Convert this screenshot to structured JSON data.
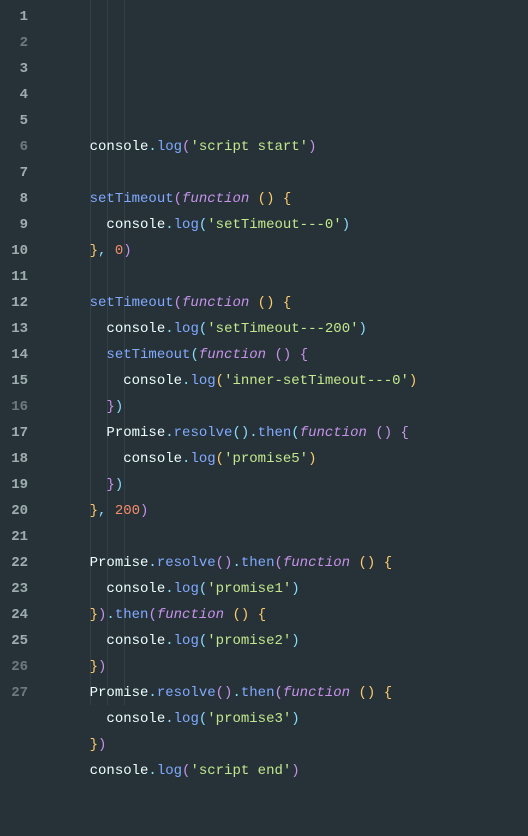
{
  "editor": {
    "line_numbers": [
      "1",
      "2",
      "3",
      "4",
      "5",
      "6",
      "7",
      "8",
      "9",
      "10",
      "11",
      "12",
      "13",
      "14",
      "15",
      "16",
      "17",
      "18",
      "19",
      "20",
      "21",
      "22",
      "23",
      "24",
      "25",
      "26",
      "27"
    ],
    "lines": [
      [
        {
          "t": "    ",
          "c": "tok-obj"
        },
        {
          "t": "console",
          "c": "tok-obj"
        },
        {
          "t": ".",
          "c": "tok-punc"
        },
        {
          "t": "log",
          "c": "tok-prop"
        },
        {
          "t": "(",
          "c": "tok-brace2"
        },
        {
          "t": "'script start'",
          "c": "tok-str"
        },
        {
          "t": ")",
          "c": "tok-brace2"
        }
      ],
      [],
      [
        {
          "t": "    ",
          "c": "tok-obj"
        },
        {
          "t": "setTimeout",
          "c": "tok-prop"
        },
        {
          "t": "(",
          "c": "tok-brace2"
        },
        {
          "t": "function ",
          "c": "tok-kw"
        },
        {
          "t": "(",
          "c": "tok-brace"
        },
        {
          "t": ")",
          "c": "tok-brace"
        },
        {
          "t": " ",
          "c": "tok-obj"
        },
        {
          "t": "{",
          "c": "tok-brace"
        }
      ],
      [
        {
          "t": "      ",
          "c": "tok-obj"
        },
        {
          "t": "console",
          "c": "tok-obj"
        },
        {
          "t": ".",
          "c": "tok-punc"
        },
        {
          "t": "log",
          "c": "tok-prop"
        },
        {
          "t": "(",
          "c": "tok-brace3"
        },
        {
          "t": "'setTimeout---0'",
          "c": "tok-str"
        },
        {
          "t": ")",
          "c": "tok-brace3"
        }
      ],
      [
        {
          "t": "    ",
          "c": "tok-obj"
        },
        {
          "t": "}",
          "c": "tok-brace"
        },
        {
          "t": ",",
          "c": "tok-punc"
        },
        {
          "t": " ",
          "c": "tok-obj"
        },
        {
          "t": "0",
          "c": "tok-num"
        },
        {
          "t": ")",
          "c": "tok-brace2"
        }
      ],
      [],
      [
        {
          "t": "    ",
          "c": "tok-obj"
        },
        {
          "t": "setTimeout",
          "c": "tok-prop"
        },
        {
          "t": "(",
          "c": "tok-brace2"
        },
        {
          "t": "function ",
          "c": "tok-kw"
        },
        {
          "t": "(",
          "c": "tok-brace"
        },
        {
          "t": ")",
          "c": "tok-brace"
        },
        {
          "t": " ",
          "c": "tok-obj"
        },
        {
          "t": "{",
          "c": "tok-brace"
        }
      ],
      [
        {
          "t": "      ",
          "c": "tok-obj"
        },
        {
          "t": "console",
          "c": "tok-obj"
        },
        {
          "t": ".",
          "c": "tok-punc"
        },
        {
          "t": "log",
          "c": "tok-prop"
        },
        {
          "t": "(",
          "c": "tok-brace3"
        },
        {
          "t": "'setTimeout---200'",
          "c": "tok-str"
        },
        {
          "t": ")",
          "c": "tok-brace3"
        }
      ],
      [
        {
          "t": "      ",
          "c": "tok-obj"
        },
        {
          "t": "setTimeout",
          "c": "tok-prop"
        },
        {
          "t": "(",
          "c": "tok-brace3"
        },
        {
          "t": "function ",
          "c": "tok-kw"
        },
        {
          "t": "(",
          "c": "tok-brace2"
        },
        {
          "t": ")",
          "c": "tok-brace2"
        },
        {
          "t": " ",
          "c": "tok-obj"
        },
        {
          "t": "{",
          "c": "tok-brace2"
        }
      ],
      [
        {
          "t": "        ",
          "c": "tok-obj"
        },
        {
          "t": "console",
          "c": "tok-obj"
        },
        {
          "t": ".",
          "c": "tok-punc"
        },
        {
          "t": "log",
          "c": "tok-prop"
        },
        {
          "t": "(",
          "c": "tok-brace"
        },
        {
          "t": "'inner-setTimeout---0'",
          "c": "tok-str"
        },
        {
          "t": ")",
          "c": "tok-brace"
        }
      ],
      [
        {
          "t": "      ",
          "c": "tok-obj"
        },
        {
          "t": "}",
          "c": "tok-brace2"
        },
        {
          "t": ")",
          "c": "tok-brace3"
        }
      ],
      [
        {
          "t": "      ",
          "c": "tok-obj"
        },
        {
          "t": "Promise",
          "c": "tok-obj"
        },
        {
          "t": ".",
          "c": "tok-punc"
        },
        {
          "t": "resolve",
          "c": "tok-prop"
        },
        {
          "t": "(",
          "c": "tok-brace3"
        },
        {
          "t": ")",
          "c": "tok-brace3"
        },
        {
          "t": ".",
          "c": "tok-punc"
        },
        {
          "t": "then",
          "c": "tok-prop"
        },
        {
          "t": "(",
          "c": "tok-brace3"
        },
        {
          "t": "function ",
          "c": "tok-kw"
        },
        {
          "t": "(",
          "c": "tok-brace2"
        },
        {
          "t": ")",
          "c": "tok-brace2"
        },
        {
          "t": " ",
          "c": "tok-obj"
        },
        {
          "t": "{",
          "c": "tok-brace2"
        }
      ],
      [
        {
          "t": "        ",
          "c": "tok-obj"
        },
        {
          "t": "console",
          "c": "tok-obj"
        },
        {
          "t": ".",
          "c": "tok-punc"
        },
        {
          "t": "log",
          "c": "tok-prop"
        },
        {
          "t": "(",
          "c": "tok-brace"
        },
        {
          "t": "'promise5'",
          "c": "tok-str"
        },
        {
          "t": ")",
          "c": "tok-brace"
        }
      ],
      [
        {
          "t": "      ",
          "c": "tok-obj"
        },
        {
          "t": "}",
          "c": "tok-brace2"
        },
        {
          "t": ")",
          "c": "tok-brace3"
        }
      ],
      [
        {
          "t": "    ",
          "c": "tok-obj"
        },
        {
          "t": "}",
          "c": "tok-brace"
        },
        {
          "t": ",",
          "c": "tok-punc"
        },
        {
          "t": " ",
          "c": "tok-obj"
        },
        {
          "t": "200",
          "c": "tok-num"
        },
        {
          "t": ")",
          "c": "tok-brace2"
        }
      ],
      [],
      [
        {
          "t": "    ",
          "c": "tok-obj"
        },
        {
          "t": "Promise",
          "c": "tok-obj"
        },
        {
          "t": ".",
          "c": "tok-punc"
        },
        {
          "t": "resolve",
          "c": "tok-prop"
        },
        {
          "t": "(",
          "c": "tok-brace2"
        },
        {
          "t": ")",
          "c": "tok-brace2"
        },
        {
          "t": ".",
          "c": "tok-punc"
        },
        {
          "t": "then",
          "c": "tok-prop"
        },
        {
          "t": "(",
          "c": "tok-brace2"
        },
        {
          "t": "function ",
          "c": "tok-kw"
        },
        {
          "t": "(",
          "c": "tok-brace"
        },
        {
          "t": ")",
          "c": "tok-brace"
        },
        {
          "t": " ",
          "c": "tok-obj"
        },
        {
          "t": "{",
          "c": "tok-brace"
        }
      ],
      [
        {
          "t": "      ",
          "c": "tok-obj"
        },
        {
          "t": "console",
          "c": "tok-obj"
        },
        {
          "t": ".",
          "c": "tok-punc"
        },
        {
          "t": "log",
          "c": "tok-prop"
        },
        {
          "t": "(",
          "c": "tok-brace3"
        },
        {
          "t": "'promise1'",
          "c": "tok-str"
        },
        {
          "t": ")",
          "c": "tok-brace3"
        }
      ],
      [
        {
          "t": "    ",
          "c": "tok-obj"
        },
        {
          "t": "}",
          "c": "tok-brace"
        },
        {
          "t": ")",
          "c": "tok-brace2"
        },
        {
          "t": ".",
          "c": "tok-punc"
        },
        {
          "t": "then",
          "c": "tok-prop"
        },
        {
          "t": "(",
          "c": "tok-brace2"
        },
        {
          "t": "function ",
          "c": "tok-kw"
        },
        {
          "t": "(",
          "c": "tok-brace"
        },
        {
          "t": ")",
          "c": "tok-brace"
        },
        {
          "t": " ",
          "c": "tok-obj"
        },
        {
          "t": "{",
          "c": "tok-brace"
        }
      ],
      [
        {
          "t": "      ",
          "c": "tok-obj"
        },
        {
          "t": "console",
          "c": "tok-obj"
        },
        {
          "t": ".",
          "c": "tok-punc"
        },
        {
          "t": "log",
          "c": "tok-prop"
        },
        {
          "t": "(",
          "c": "tok-brace3"
        },
        {
          "t": "'promise2'",
          "c": "tok-str"
        },
        {
          "t": ")",
          "c": "tok-brace3"
        }
      ],
      [
        {
          "t": "    ",
          "c": "tok-obj"
        },
        {
          "t": "}",
          "c": "tok-brace"
        },
        {
          "t": ")",
          "c": "tok-brace2"
        }
      ],
      [
        {
          "t": "    ",
          "c": "tok-obj"
        },
        {
          "t": "Promise",
          "c": "tok-obj"
        },
        {
          "t": ".",
          "c": "tok-punc"
        },
        {
          "t": "resolve",
          "c": "tok-prop"
        },
        {
          "t": "(",
          "c": "tok-brace2"
        },
        {
          "t": ")",
          "c": "tok-brace2"
        },
        {
          "t": ".",
          "c": "tok-punc"
        },
        {
          "t": "then",
          "c": "tok-prop"
        },
        {
          "t": "(",
          "c": "tok-brace2"
        },
        {
          "t": "function ",
          "c": "tok-kw"
        },
        {
          "t": "(",
          "c": "tok-brace"
        },
        {
          "t": ")",
          "c": "tok-brace"
        },
        {
          "t": " ",
          "c": "tok-obj"
        },
        {
          "t": "{",
          "c": "tok-brace"
        }
      ],
      [
        {
          "t": "      ",
          "c": "tok-obj"
        },
        {
          "t": "console",
          "c": "tok-obj"
        },
        {
          "t": ".",
          "c": "tok-punc"
        },
        {
          "t": "log",
          "c": "tok-prop"
        },
        {
          "t": "(",
          "c": "tok-brace3"
        },
        {
          "t": "'promise3'",
          "c": "tok-str"
        },
        {
          "t": ")",
          "c": "tok-brace3"
        }
      ],
      [
        {
          "t": "    ",
          "c": "tok-obj"
        },
        {
          "t": "}",
          "c": "tok-brace"
        },
        {
          "t": ")",
          "c": "tok-brace2"
        }
      ],
      [
        {
          "t": "    ",
          "c": "tok-obj"
        },
        {
          "t": "console",
          "c": "tok-obj"
        },
        {
          "t": ".",
          "c": "tok-punc"
        },
        {
          "t": "log",
          "c": "tok-prop"
        },
        {
          "t": "(",
          "c": "tok-brace2"
        },
        {
          "t": "'script end'",
          "c": "tok-str"
        },
        {
          "t": ")",
          "c": "tok-brace2"
        }
      ],
      [],
      []
    ]
  }
}
